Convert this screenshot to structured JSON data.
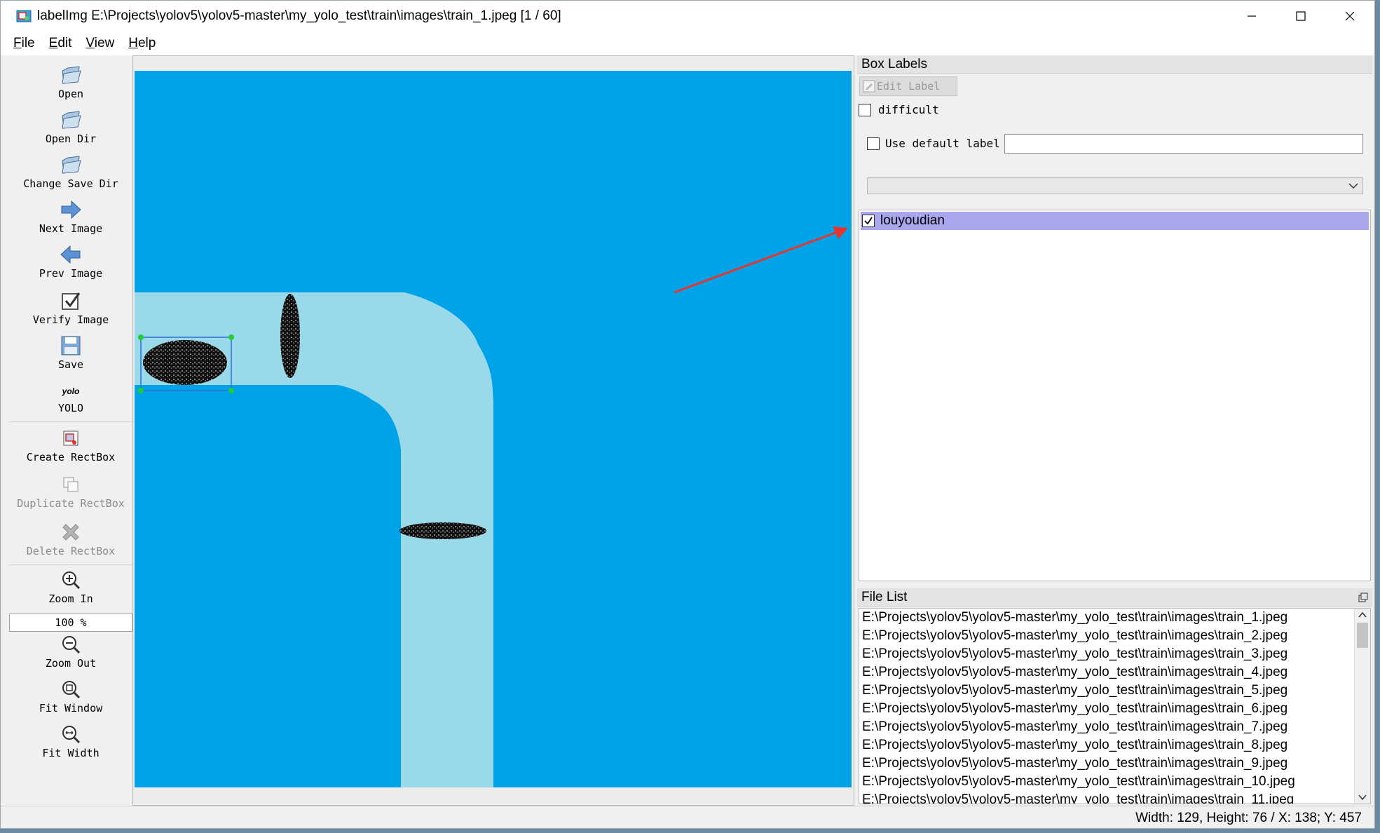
{
  "window": {
    "title": "labelImg E:\\Projects\\yolov5\\yolov5-master\\my_yolo_test\\train\\images\\train_1.jpeg [1 / 60]"
  },
  "menu": [
    "File",
    "Edit",
    "View",
    "Help"
  ],
  "toolbar": {
    "open": "Open",
    "open_dir": "Open Dir",
    "change_save_dir": "Change Save Dir",
    "next_image": "Next Image",
    "prev_image": "Prev Image",
    "verify_image": "Verify Image",
    "save": "Save",
    "yolo_icon_text": "yolo",
    "yolo": "YOLO",
    "create_rectbox": "Create RectBox",
    "duplicate_rectbox": "Duplicate RectBox",
    "delete_rectbox": "Delete RectBox",
    "zoom_in": "Zoom In",
    "zoom_value": "100 %",
    "zoom_out": "Zoom Out",
    "fit_window": "Fit Window",
    "fit_width": "Fit Width"
  },
  "box_labels": {
    "title": "Box Labels",
    "edit_label": "Edit Label",
    "difficult": "difficult",
    "difficult_checked": false,
    "use_default_label": "Use default label",
    "use_default_checked": false,
    "default_label_value": "",
    "labels": [
      {
        "name": "louyoudian",
        "checked": true
      }
    ]
  },
  "file_list": {
    "title": "File List",
    "files": [
      "E:\\Projects\\yolov5\\yolov5-master\\my_yolo_test\\train\\images\\train_1.jpeg",
      "E:\\Projects\\yolov5\\yolov5-master\\my_yolo_test\\train\\images\\train_2.jpeg",
      "E:\\Projects\\yolov5\\yolov5-master\\my_yolo_test\\train\\images\\train_3.jpeg",
      "E:\\Projects\\yolov5\\yolov5-master\\my_yolo_test\\train\\images\\train_4.jpeg",
      "E:\\Projects\\yolov5\\yolov5-master\\my_yolo_test\\train\\images\\train_5.jpeg",
      "E:\\Projects\\yolov5\\yolov5-master\\my_yolo_test\\train\\images\\train_6.jpeg",
      "E:\\Projects\\yolov5\\yolov5-master\\my_yolo_test\\train\\images\\train_7.jpeg",
      "E:\\Projects\\yolov5\\yolov5-master\\my_yolo_test\\train\\images\\train_8.jpeg",
      "E:\\Projects\\yolov5\\yolov5-master\\my_yolo_test\\train\\images\\train_9.jpeg",
      "E:\\Projects\\yolov5\\yolov5-master\\my_yolo_test\\train\\images\\train_10.jpeg",
      "E:\\Projects\\yolov5\\yolov5-master\\my_yolo_test\\train\\images\\train_11.jpeg"
    ]
  },
  "status": "Width: 129, Height: 76 / X: 138; Y: 457",
  "colors": {
    "image_background": "#00a2e8",
    "road": "#99d9ea",
    "selected_label_row": "#a9a6ee",
    "annotation_arrow": "#e8352b",
    "bbox_outline": "#2a6fd6",
    "bbox_handle": "#22cc33"
  }
}
